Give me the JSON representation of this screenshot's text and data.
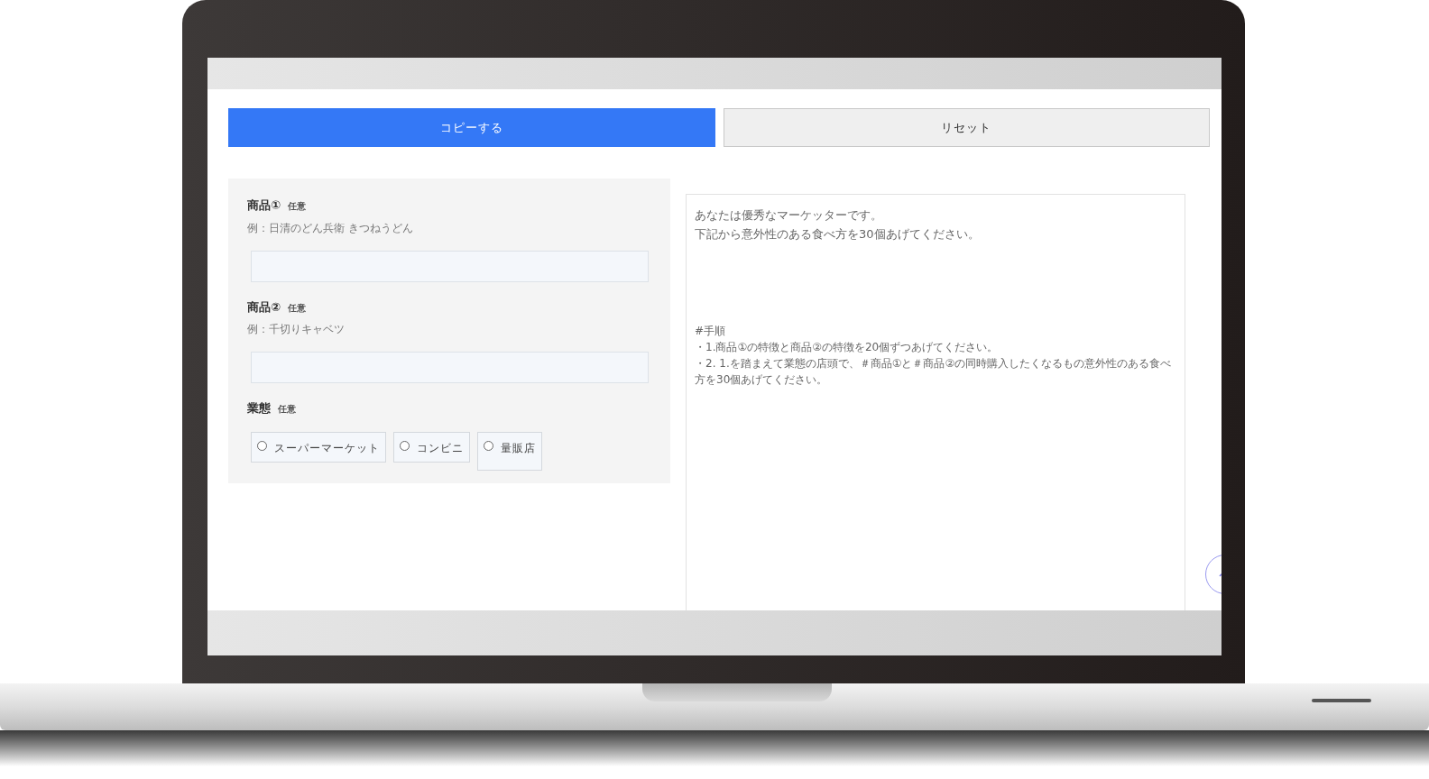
{
  "buttons": [
    {
      "label": "コピーする",
      "kind": "primary"
    },
    {
      "label": "リセット",
      "kind": "secondary"
    }
  ],
  "form": {
    "fields": [
      {
        "kind": "text",
        "label": "商品①",
        "badge": "任意",
        "example": "例：日清のどん兵衛 きつねうどん"
      },
      {
        "kind": "text",
        "label": "商品②",
        "badge": "任意",
        "example": "例：千切りキャベツ"
      },
      {
        "kind": "radio",
        "label": "業態",
        "badge": "任意",
        "options": [
          {
            "label": "スーパーマーケット",
            "selected": false
          },
          {
            "label": "コンビニ",
            "selected": false
          },
          {
            "label": "量販店",
            "selected": false
          }
        ]
      }
    ]
  },
  "prompt": {
    "intro": [
      "あなたは優秀なマーケッターです。",
      "下記から意外性のある食べ方を30個あげてください。"
    ],
    "steps": [
      "#手順",
      "・1.商品①の特徴と商品②の特徴を20個ずつあげてください。",
      "・2. 1.を踏まえて業態の店頭で、＃商品①と＃商品②の同時購入したくなるもの意外性のある食べ方を30個あげてください。"
    ]
  }
}
